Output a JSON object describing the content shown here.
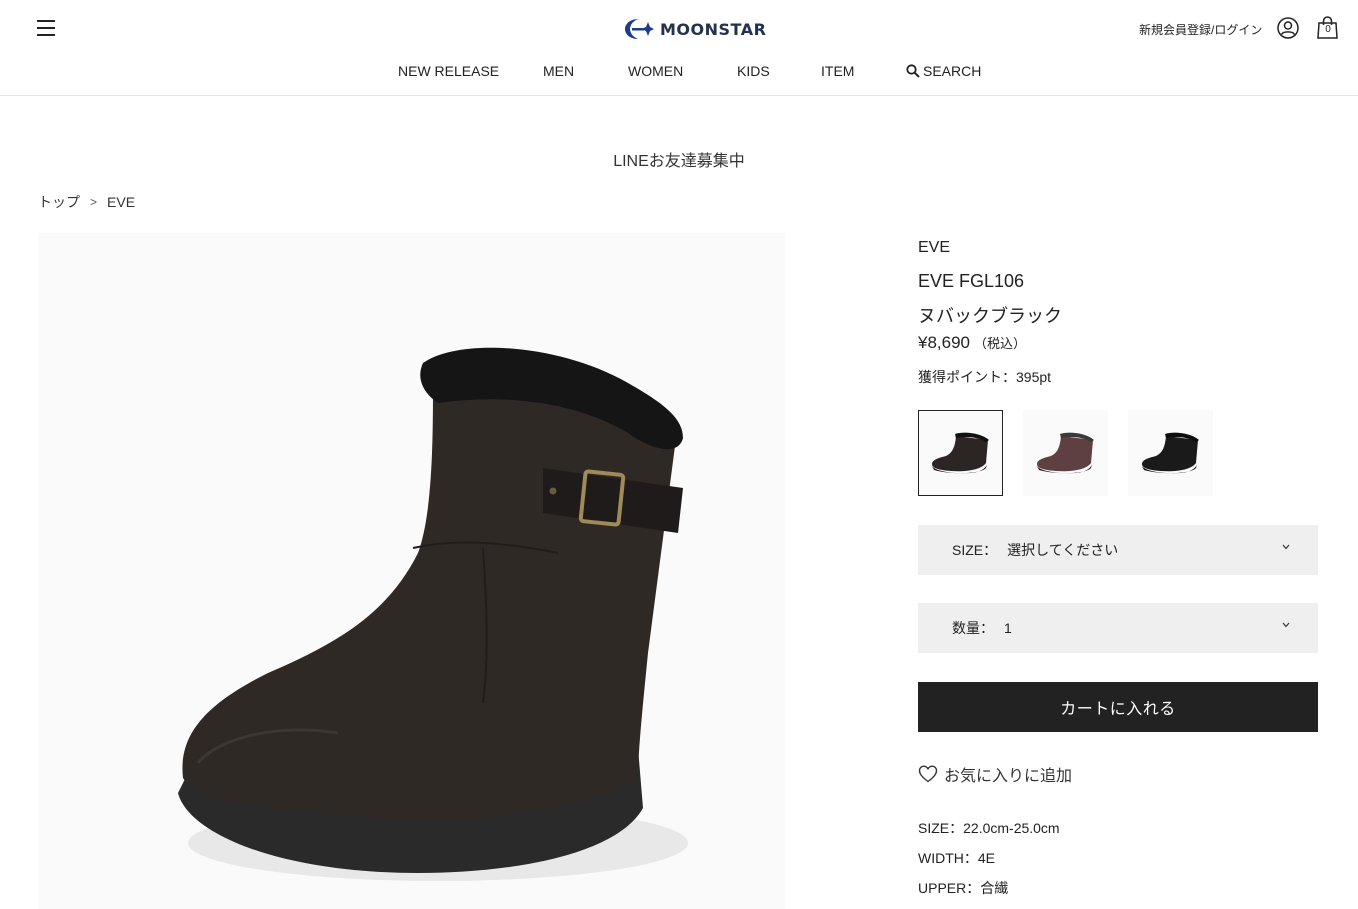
{
  "header": {
    "menu_icon": "hamburger-menu-icon",
    "logo_text": "MOONSTAR",
    "login_label": "新規会員登録/ログイン",
    "user_icon": "user-account-icon",
    "cart_icon": "shopping-bag-icon",
    "cart_count": "0"
  },
  "nav": {
    "items": [
      {
        "label": "NEW RELEASE"
      },
      {
        "label": "MEN"
      },
      {
        "label": "WOMEN"
      },
      {
        "label": "KIDS"
      },
      {
        "label": "ITEM"
      },
      {
        "label": "SEARCH",
        "icon": "search-icon"
      }
    ]
  },
  "banner": {
    "text": "LINEお友達募集中"
  },
  "breadcrumb": {
    "items": [
      {
        "label": "トップ"
      },
      {
        "label": "EVE"
      }
    ],
    "separator": ">"
  },
  "product": {
    "brand": "EVE",
    "name": "EVE FGL106",
    "color": "ヌバックブラック",
    "price": "¥8,690",
    "tax_note": "（税込）",
    "points": "獲得ポイント：395pt",
    "image_alt": "black-suede-boot-photo",
    "swatches": [
      {
        "name": "black-suede",
        "color": "#2b2623",
        "selected": true
      },
      {
        "name": "burgundy",
        "color": "#5e3f42",
        "selected": false
      },
      {
        "name": "black-leather",
        "color": "#1a1a1a",
        "selected": false
      }
    ]
  },
  "selectors": {
    "size_label": "SIZE：",
    "size_value": "選択してください",
    "qty_label": "数量：",
    "qty_value": "1"
  },
  "actions": {
    "add_to_cart": "カートに入れる",
    "favorite": "お気に入りに追加"
  },
  "specs": {
    "size": "SIZE：22.0cm-25.0cm",
    "width": "WIDTH：4E",
    "upper": "UPPER：合繊"
  },
  "colors": {
    "logo_blue": "#1d3b8c",
    "button_dark": "#222222",
    "select_bg": "#efefef"
  }
}
